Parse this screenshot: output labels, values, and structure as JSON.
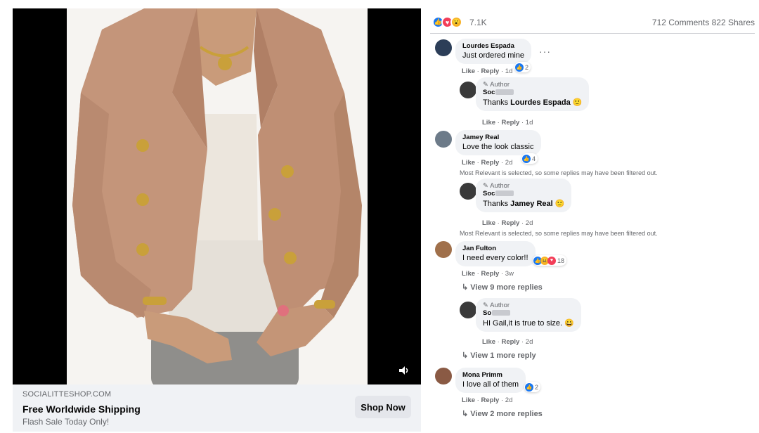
{
  "ad": {
    "domain": "SOCIALITTESHOP.COM",
    "headline": "Free Worldwide Shipping",
    "subline": "Flash Sale Today Only!",
    "cta": "Shop Now"
  },
  "stats": {
    "reactions": "7.1K",
    "comments": "712 Comments",
    "shares": "822 Shares",
    "reaction_icons": [
      "like-icon",
      "love-icon",
      "wow-icon"
    ]
  },
  "comments": [
    {
      "name": "Lourdes Espada",
      "text": "Just ordered mine",
      "like": "Like",
      "reply": "Reply",
      "time": "1d",
      "reactions": "2"
    },
    {
      "author_label": "Author",
      "name": "Soc",
      "text_prefix": "Thanks",
      "mention": "Lourdes Espada",
      "emoji": "🙂",
      "like": "Like",
      "reply": "Reply",
      "time": "1d"
    },
    {
      "name": "Jamey Real",
      "text": "Love the look classic",
      "like": "Like",
      "reply": "Reply",
      "time": "2d",
      "reactions": "4"
    },
    {
      "notice": "Most Relevant is selected, so some replies may have been filtered out."
    },
    {
      "author_label": "Author",
      "name": "Soc",
      "text_prefix": "Thanks",
      "mention": "Jamey Real",
      "emoji": "🙂",
      "like": "Like",
      "reply": "Reply",
      "time": "2d"
    },
    {
      "notice": "Most Relevant is selected, so some replies may have been filtered out."
    },
    {
      "name": "Jan Fulton",
      "text": "I need every color!!",
      "like": "Like",
      "reply": "Reply",
      "time": "3w",
      "reactions": "18",
      "view_more": "View 9 more replies"
    },
    {
      "author_label": "Author",
      "name": "So",
      "text": "HI Gail,it is true to size.",
      "emoji": "😀",
      "like": "Like",
      "reply": "Reply",
      "time": "2d",
      "view_more": "View 1 more reply"
    },
    {
      "name": "Mona Primm",
      "text": "I love all of them",
      "like": "Like",
      "reply": "Reply",
      "time": "2d",
      "reactions": "2",
      "view_more": "View 2 more replies"
    }
  ],
  "colors": {
    "like": "#1877f2",
    "love": "#f33e58",
    "wow": "#f7b125",
    "bubble": "#f0f2f5",
    "meta": "#65676b"
  }
}
